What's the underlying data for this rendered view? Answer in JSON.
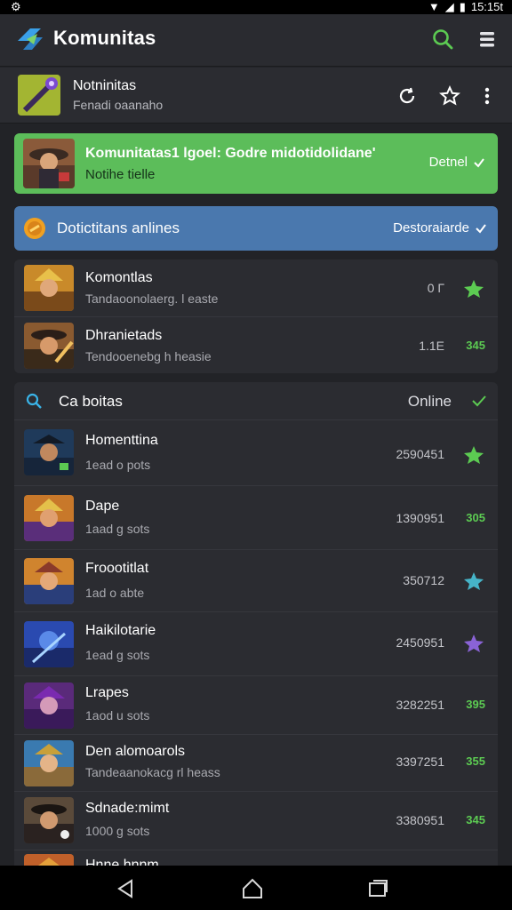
{
  "status_bar": {
    "left_icon": "debug-icon",
    "time": "15:15t"
  },
  "app_bar": {
    "title": "Komunitas",
    "logo": "app-logo-icon",
    "search_icon": "search-icon",
    "menu_icon": "menu-icon"
  },
  "profile": {
    "name": "Notninitas",
    "subtitle": "Fenadi oaanaho"
  },
  "banner_green": {
    "title": "Komunitatas1 lgoel: Godre midotidolidane'",
    "subtitle": "Notihe tielle",
    "action": "Detnel"
  },
  "banner_blue": {
    "title": "Dotictitans anlines",
    "action": "Destoraiarde"
  },
  "top_list": [
    {
      "name": "Komontlas",
      "subtitle": "Tandaoonolaerg. l easte",
      "value": "0 Г",
      "badge": "star"
    },
    {
      "name": "Dhranietads",
      "subtitle": "Tendooenebg h heasie",
      "value": "1.1Е",
      "badge": "345"
    }
  ],
  "online_section": {
    "title": "Ca boitas",
    "status": "Online"
  },
  "online_list": [
    {
      "name": "Homenttina",
      "subtitle": "1ead o pots",
      "value": "2590451",
      "badge": "star",
      "badge_color": "#5ccb52"
    },
    {
      "name": "Dape",
      "subtitle": "1aad g sots",
      "value": "1390951",
      "badge": "305",
      "badge_color": "#5ccb52"
    },
    {
      "name": "Froootitlat",
      "subtitle": "1ad o abte",
      "value": "350712",
      "badge": "star",
      "badge_color": "#46b4c8"
    },
    {
      "name": "Haikilotarie",
      "subtitle": "1ead g sots",
      "value": "2450951",
      "badge": "star",
      "badge_color": "#8a63d6"
    },
    {
      "name": "Lrapes",
      "subtitle": "1aod u sots",
      "value": "3282251",
      "badge": "395",
      "badge_color": "#5ccb52"
    },
    {
      "name": "Den alomoarols",
      "subtitle": "Tandeaanokacg rl heass",
      "value": "3397251",
      "badge": "355",
      "badge_color": "#5ccb52"
    },
    {
      "name": "Sdnade:mimt",
      "subtitle": "1000 g sots",
      "value": "3380951",
      "badge": "345",
      "badge_color": "#5ccb52"
    },
    {
      "name": "Hnne hnnm",
      "subtitle": "",
      "value": "",
      "badge": "",
      "badge_color": "#5ccb52"
    }
  ],
  "colors": {
    "accent_green": "#5cbd5a",
    "accent_blue": "#4a78ae",
    "background": "#222327",
    "card": "#2b2c31"
  }
}
